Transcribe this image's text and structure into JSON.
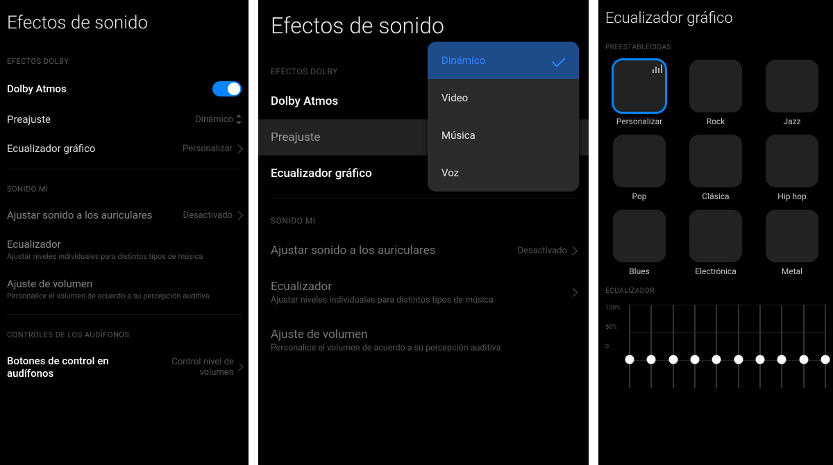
{
  "panel1": {
    "title": "Efectos de sonido",
    "sections": {
      "dolby": {
        "header": "EFECTOS DOLBY",
        "atmos_label": "Dolby Atmos",
        "preset_label": "Preajuste",
        "preset_value": "Dinámico",
        "eq_label": "Ecualizador gráfico",
        "eq_value": "Personalizar"
      },
      "mi": {
        "header": "SONIDO MI",
        "headphone_label": "Ajustar sonido a los auriculares",
        "headphone_value": "Desactivado",
        "equalizer_label": "Ecualizador",
        "equalizer_sub": "Ajustar niveles individuales para distintos tipos de música",
        "volume_label": "Ajuste de volumen",
        "volume_sub": "Personalice el volumen de acuerdo a su percepción auditiva"
      },
      "controls": {
        "header": "CONTROLES DE LOS AUDÍFONOS",
        "buttons_label": "Botones de control en audífonos",
        "buttons_value": "Control nivel de volumen"
      }
    }
  },
  "panel2": {
    "title": "Efectos de sonido",
    "sections": {
      "dolby": {
        "header": "EFECTOS DOLBY",
        "atmos_label": "Dolby Atmos",
        "preset_label": "Preajuste",
        "eq_label": "Ecualizador gráfico"
      },
      "mi": {
        "header": "SONIDO MI",
        "headphone_label": "Ajustar sonido a los auriculares",
        "headphone_value": "Desactivado",
        "equalizer_label": "Ecualizador",
        "equalizer_sub": "Ajustar niveles individuales para distintos tipos de música",
        "volume_label": "Ajuste de volumen",
        "volume_sub": "Personalice el volumen de acuerdo a su percepción auditiva"
      }
    },
    "popup": {
      "options": [
        "Dinámico",
        "Video",
        "Música",
        "Voz"
      ],
      "selected": "Dinámico"
    }
  },
  "panel3": {
    "title": "Ecualizador gráfico",
    "presets_header": "PREESTABLECIDAS",
    "presets": [
      {
        "name": "Personalizar",
        "thumb": "th-personalizar",
        "selected": true
      },
      {
        "name": "Rock",
        "thumb": "th-rock"
      },
      {
        "name": "Jazz",
        "thumb": "th-jazz"
      },
      {
        "name": "Pop",
        "thumb": "th-pop"
      },
      {
        "name": "Clásica",
        "thumb": "th-clasica"
      },
      {
        "name": "Hip hop",
        "thumb": "th-hiphop"
      },
      {
        "name": "Blues",
        "thumb": "th-blues"
      },
      {
        "name": "Electrónica",
        "thumb": "th-electronica"
      },
      {
        "name": "Metal",
        "thumb": "th-metal"
      }
    ],
    "eq_header": "ECUALIZADOR",
    "eq_scale": [
      "100%",
      "50%",
      "0"
    ],
    "eq_bands": 10
  }
}
